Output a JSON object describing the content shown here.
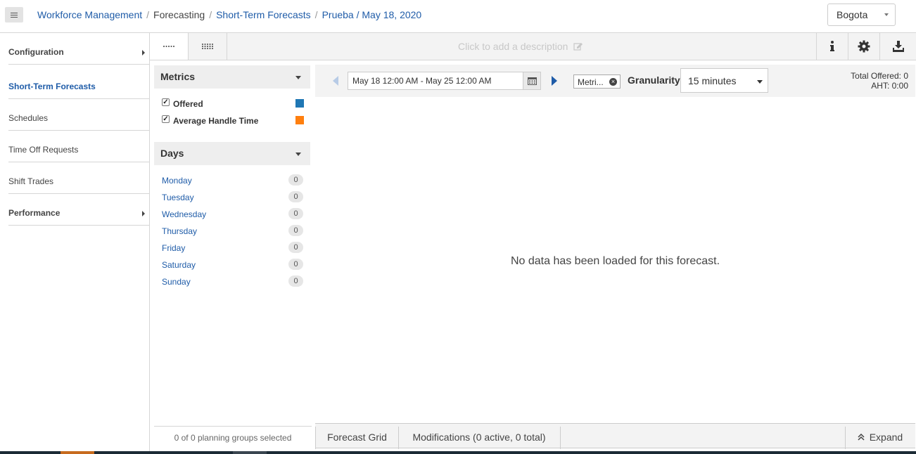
{
  "header": {
    "breadcrumb": {
      "workforce": "Workforce Management",
      "forecasting": "Forecasting",
      "short_term": "Short-Term Forecasts",
      "current": "Prueba / May 18, 2020",
      "separator": "/"
    },
    "timezone": "Bogota"
  },
  "sidebar": {
    "items": [
      {
        "label": "Configuration"
      },
      {
        "label": "Short-Term Forecasts"
      },
      {
        "label": "Schedules"
      },
      {
        "label": "Time Off Requests"
      },
      {
        "label": "Shift Trades"
      },
      {
        "label": "Performance"
      }
    ]
  },
  "toolbar": {
    "description_placeholder": "Click to add a description"
  },
  "metrics": {
    "title": "Metrics",
    "items": [
      {
        "label": "Offered",
        "checked": true,
        "color": "#1f77b4"
      },
      {
        "label": "Average Handle Time",
        "checked": true,
        "color": "#ff7f0e"
      }
    ]
  },
  "days": {
    "title": "Days",
    "items": [
      {
        "label": "Monday",
        "count": "0"
      },
      {
        "label": "Tuesday",
        "count": "0"
      },
      {
        "label": "Wednesday",
        "count": "0"
      },
      {
        "label": "Thursday",
        "count": "0"
      },
      {
        "label": "Friday",
        "count": "0"
      },
      {
        "label": "Saturday",
        "count": "0"
      },
      {
        "label": "Sunday",
        "count": "0"
      }
    ]
  },
  "range": {
    "date_range": "May 18 12:00 AM - May 25 12:00 AM",
    "metric_chip": "Metri...",
    "granularity_label": "Granularity",
    "granularity_value": "15 minutes",
    "total_offered": "Total Offered: 0",
    "aht": "AHT: 0:00"
  },
  "main": {
    "empty_message": "No data has been loaded for this forecast."
  },
  "footer": {
    "planning_groups": "0 of 0 planning groups selected",
    "tabs": [
      "Forecast Grid",
      "Modifications (0 active, 0 total)"
    ],
    "expand": "Expand"
  }
}
